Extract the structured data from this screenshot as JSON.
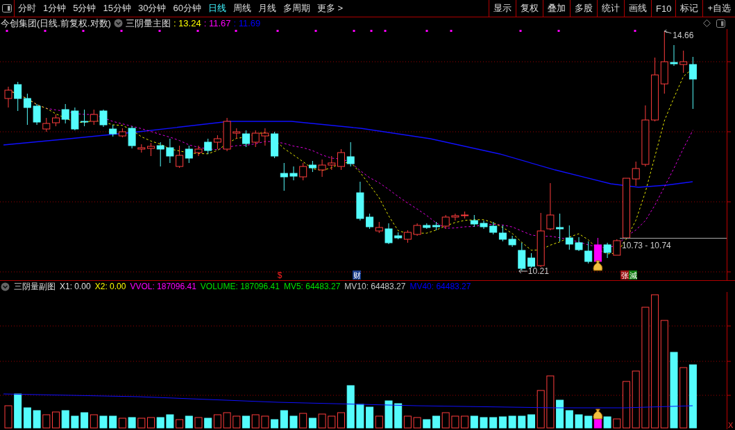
{
  "toolbar": {
    "periods": [
      {
        "label": "分时",
        "selected": false
      },
      {
        "label": "1分钟",
        "selected": false
      },
      {
        "label": "5分钟",
        "selected": false
      },
      {
        "label": "15分钟",
        "selected": false
      },
      {
        "label": "30分钟",
        "selected": false
      },
      {
        "label": "60分钟",
        "selected": false
      },
      {
        "label": "日线",
        "selected": true
      },
      {
        "label": "周线",
        "selected": false
      },
      {
        "label": "月线",
        "selected": false
      },
      {
        "label": "多周期",
        "selected": false
      },
      {
        "label": "更多 >",
        "selected": false
      }
    ],
    "buttons": [
      "显示",
      "复权",
      "叠加",
      "多股",
      "统计",
      "画线",
      "F10",
      "标记",
      "+自选"
    ]
  },
  "main_chart": {
    "title": "今创集团(日线.前复权.对数)",
    "indicator": "三阴量主图",
    "values": [
      {
        "text": ": 13.24",
        "color": "#ffff00"
      },
      {
        "text": ": 11.67",
        "color": "#ff00ff"
      },
      {
        "text": ": 11.69",
        "color": "#0000ff"
      }
    ],
    "high_label": "14.66",
    "low_label": "10.21",
    "range_label": "10.73 - 10.74",
    "signals": [
      {
        "kind": "text",
        "text": "$",
        "color": "#ff2020"
      },
      {
        "kind": "badge",
        "text": "财",
        "color": "#1c3f8c"
      },
      {
        "kind": "badge",
        "text": "张",
        "color": "#9c1010"
      },
      {
        "kind": "badge",
        "text": "減",
        "color": "#0f7a0f"
      }
    ]
  },
  "sub_chart": {
    "indicator": "三阴量副图",
    "values": [
      {
        "text": "X1: 0.00",
        "color": "#e0e0e0"
      },
      {
        "text": "X2: 0.00",
        "color": "#ffff00"
      },
      {
        "text": "VVOL: 187096.41",
        "color": "#ff00ff"
      },
      {
        "text": "VOLUME: 187096.41",
        "color": "#00e000"
      },
      {
        "text": "MV5: 64483.27",
        "color": "#00e000"
      },
      {
        "text": "MV10: 64483.27",
        "color": "#c8c8c8"
      },
      {
        "text": "MV40: 64483.27",
        "color": "#0000ff"
      }
    ]
  },
  "close_button": "X"
}
